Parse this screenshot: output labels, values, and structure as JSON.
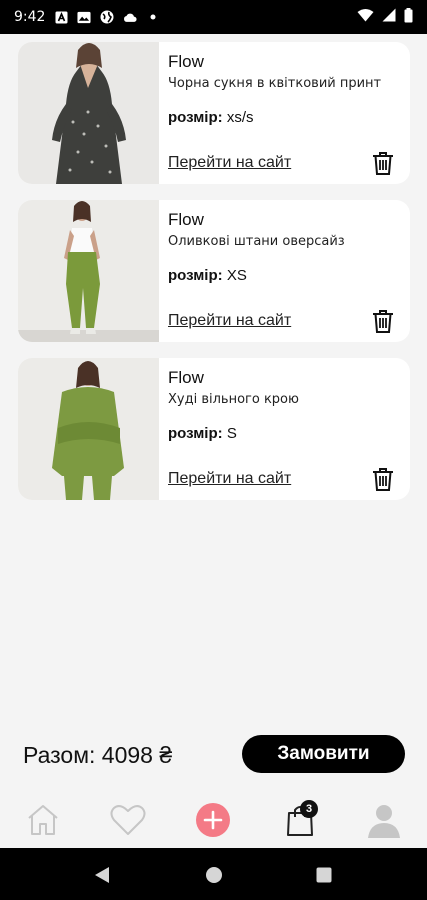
{
  "status_bar": {
    "time": "9:42",
    "left_icons": [
      "a-icon",
      "image-icon",
      "globe-icon",
      "cloud-icon",
      "dot-icon"
    ],
    "right_icons": [
      "wifi-icon",
      "signal-icon",
      "battery-icon"
    ]
  },
  "cart_items": [
    {
      "brand": "Flow",
      "description": "Чорна сукня в квітковий принт",
      "size_label": "розмір:",
      "size_value": "xs/s",
      "link_label": "Перейти на сайт"
    },
    {
      "brand": "Flow",
      "description": "Оливкові штани оверсайз",
      "size_label": "розмір:",
      "size_value": "XS",
      "link_label": "Перейти на сайт"
    },
    {
      "brand": "Flow",
      "description": "Худі вільного крою",
      "size_label": "розмір:",
      "size_value": "S",
      "link_label": "Перейти на сайт"
    }
  ],
  "summary": {
    "total_label": "Разом: 4098 ₴",
    "order_button": "Замовити"
  },
  "bottom_nav": {
    "items": [
      "home-icon",
      "heart-icon",
      "add-icon",
      "bag-icon",
      "profile-icon"
    ],
    "cart_count": "3",
    "accent_color": "#f47a86"
  },
  "android_nav": [
    "back-icon",
    "home-circle-icon",
    "recents-icon"
  ]
}
